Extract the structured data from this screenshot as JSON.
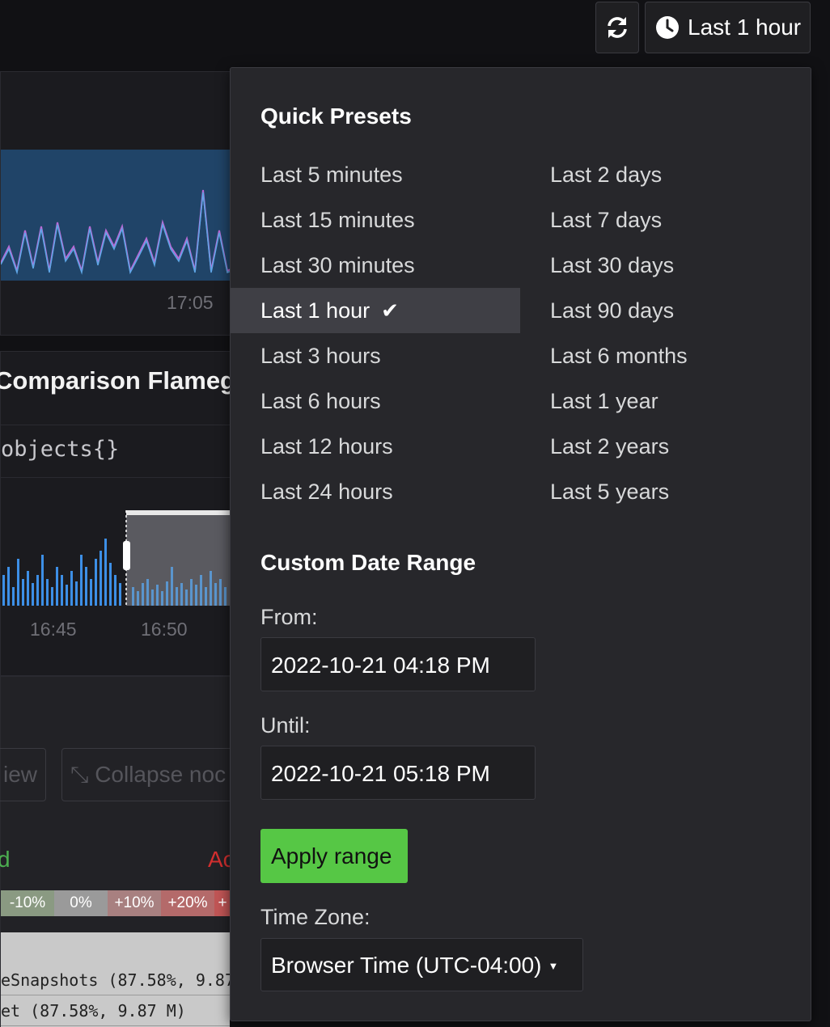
{
  "toolbar": {
    "refresh_icon": "refresh-icon",
    "time_icon": "clock-icon",
    "time_label": "Last 1 hour"
  },
  "background": {
    "panel1_tick": "17:05",
    "panel2_title": "Comparison Flameg",
    "panel2_query": "objects{}",
    "panel2_ticks": [
      "16:45",
      "16:50"
    ],
    "panel3_button_a": "iew",
    "panel3_button_b": "Collapse noc",
    "panel3_label_green": "d",
    "panel3_label_red": "Ac",
    "legend": [
      "-10%",
      "0%",
      "+10%",
      "+20%",
      "+"
    ],
    "flame_rows": [
      "eSnapshots (87.58%, 9.87",
      "et (87.58%, 9.87 M)"
    ]
  },
  "picker": {
    "quick_title": "Quick Presets",
    "presets_left": [
      "Last 5 minutes",
      "Last 15 minutes",
      "Last 30 minutes",
      "Last 1 hour",
      "Last 3 hours",
      "Last 6 hours",
      "Last 12 hours",
      "Last 24 hours"
    ],
    "presets_right": [
      "Last 2 days",
      "Last 7 days",
      "Last 30 days",
      "Last 90 days",
      "Last 6 months",
      "Last 1 year",
      "Last 2 years",
      "Last 5 years"
    ],
    "active_preset": "Last 1 hour",
    "custom_title": "Custom Date Range",
    "from_label": "From:",
    "from_value": "2022-10-21 04:18 PM",
    "until_label": "Until:",
    "until_value": "2022-10-21 05:18 PM",
    "apply_label": "Apply range",
    "timezone_label": "Time Zone:",
    "timezone_value": "Browser Time (UTC-04:00)"
  },
  "colors": {
    "accent_green": "#56c745",
    "panel_bg": "#27272b",
    "active_bg": "#3f3f45"
  }
}
